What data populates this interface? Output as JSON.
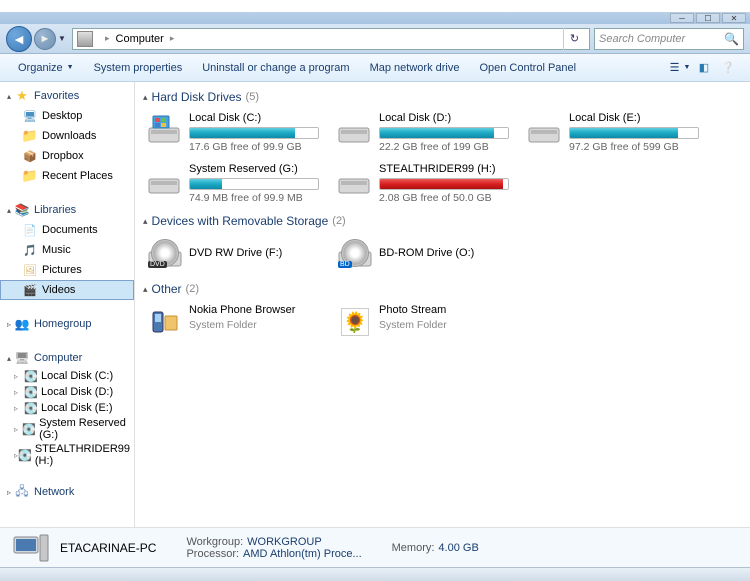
{
  "titlebar": {
    "min": "─",
    "max": "☐",
    "close": "✕"
  },
  "nav": {
    "location": "Computer",
    "sep": "▸",
    "search_placeholder": "Search Computer"
  },
  "toolbar": {
    "organize": "Organize",
    "sys_props": "System properties",
    "uninstall": "Uninstall or change a program",
    "map_drive": "Map network drive",
    "control_panel": "Open Control Panel"
  },
  "sidebar": {
    "favorites": {
      "label": "Favorites",
      "items": [
        "Desktop",
        "Downloads",
        "Dropbox",
        "Recent Places"
      ]
    },
    "libraries": {
      "label": "Libraries",
      "items": [
        "Documents",
        "Music",
        "Pictures",
        "Videos"
      ]
    },
    "homegroup": "Homegroup",
    "computer": {
      "label": "Computer",
      "drives": [
        "Local Disk (C:)",
        "Local Disk (D:)",
        "Local Disk (E:)",
        "System Reserved (G:)",
        "STEALTHRIDER99 (H:)"
      ]
    },
    "network": "Network"
  },
  "sections": {
    "hdd": {
      "title": "Hard Disk Drives",
      "count": "(5)",
      "items": [
        {
          "name": "Local Disk (C:)",
          "free": "17.6 GB free of 99.9 GB",
          "pct": 82,
          "red": false,
          "win": true
        },
        {
          "name": "Local Disk (D:)",
          "free": "22.2 GB free of 199 GB",
          "pct": 89,
          "red": false,
          "win": false
        },
        {
          "name": "Local Disk (E:)",
          "free": "97.2 GB free of 599 GB",
          "pct": 84,
          "red": false,
          "win": false
        },
        {
          "name": "System Reserved (G:)",
          "free": "74.9 MB free of 99.9 MB",
          "pct": 25,
          "red": false,
          "win": false
        },
        {
          "name": "STEALTHRIDER99 (H:)",
          "free": "2.08 GB free of 50.0 GB",
          "pct": 96,
          "red": true,
          "win": false
        }
      ]
    },
    "removable": {
      "title": "Devices with Removable Storage",
      "count": "(2)",
      "items": [
        {
          "name": "DVD RW Drive (F:)",
          "type": "dvd"
        },
        {
          "name": "BD-ROM Drive (O:)",
          "type": "bd"
        }
      ]
    },
    "other": {
      "title": "Other",
      "count": "(2)",
      "items": [
        {
          "name": "Nokia Phone Browser",
          "sub": "System Folder",
          "icon": "nokia"
        },
        {
          "name": "Photo Stream",
          "sub": "System Folder",
          "icon": "photo"
        }
      ]
    }
  },
  "details": {
    "name": "ETACARINAE-PC",
    "workgroup_l": "Workgroup:",
    "workgroup_v": "WORKGROUP",
    "processor_l": "Processor:",
    "processor_v": "AMD Athlon(tm) Proce...",
    "memory_l": "Memory:",
    "memory_v": "4.00 GB"
  }
}
